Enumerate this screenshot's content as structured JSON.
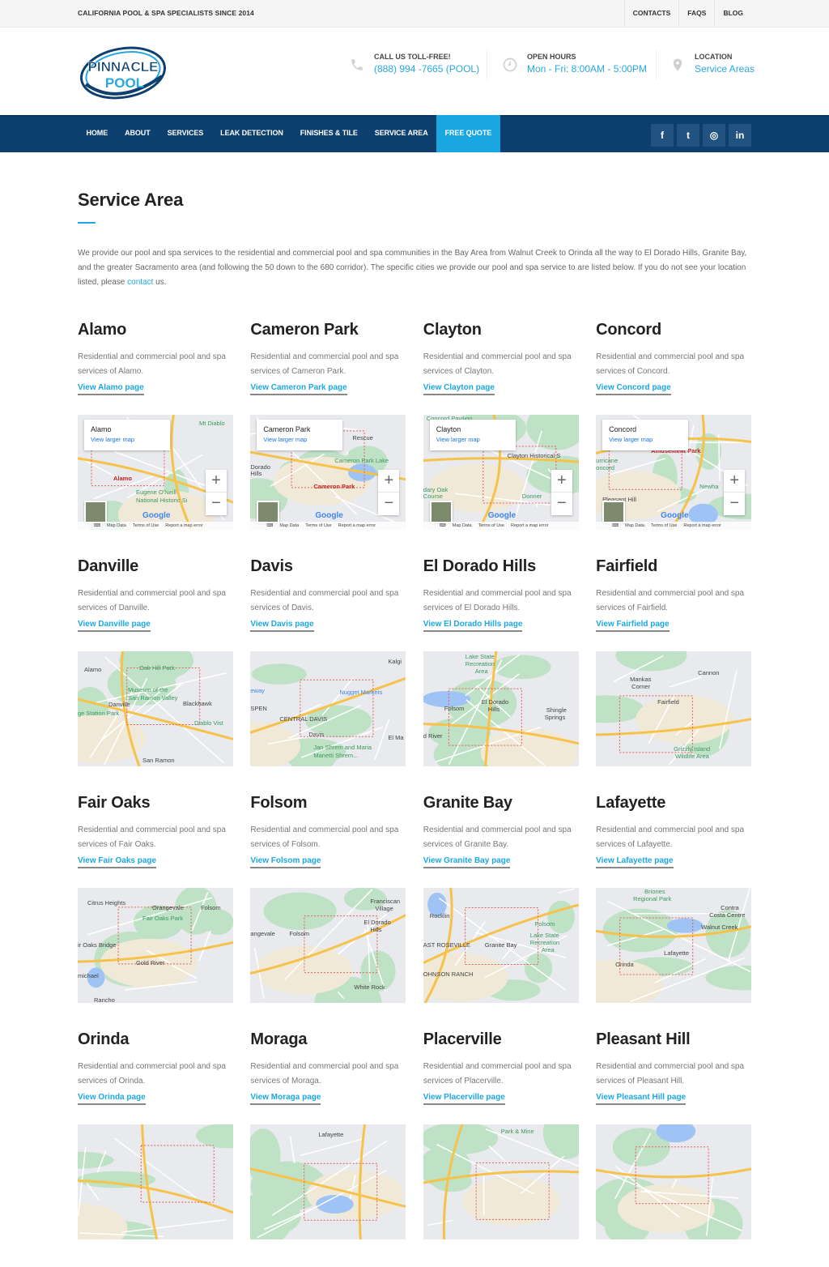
{
  "topbar": {
    "tagline": "CALIFORNIA POOL & SPA SPECIALISTS SINCE 2014",
    "links": [
      "CONTACTS",
      "FAQS",
      "BLOG"
    ]
  },
  "header": {
    "logo": {
      "line1": "PINNACLE",
      "line2": "POOL"
    },
    "info": [
      {
        "icon": "phone-icon",
        "label": "CALL US TOLL-FREE!",
        "value": "(888) 994 -7665 (POOL)"
      },
      {
        "icon": "clock-icon",
        "label": "OPEN HOURS",
        "value": "Mon - Fri: 8:00AM - 5:00PM"
      },
      {
        "icon": "location-pin-icon",
        "label": "LOCATION",
        "value": "Service Areas"
      }
    ]
  },
  "nav": {
    "items": [
      {
        "label": "HOME"
      },
      {
        "label": "ABOUT"
      },
      {
        "label": "SERVICES"
      },
      {
        "label": "LEAK DETECTION"
      },
      {
        "label": "FINISHES & TILE"
      },
      {
        "label": "SERVICE AREA"
      },
      {
        "label": "FREE QUOTE",
        "active": true
      }
    ],
    "social": [
      {
        "icon": "facebook-icon",
        "glyph": "f"
      },
      {
        "icon": "twitter-icon",
        "glyph": "t"
      },
      {
        "icon": "instagram-icon",
        "glyph": "◎"
      },
      {
        "icon": "linkedin-icon",
        "glyph": "in"
      }
    ]
  },
  "colors": {
    "brand_dark": "#0d3f6f",
    "accent": "#1ba8e2",
    "social_bg": "#22527f",
    "topbar_bg": "#f5f5f5"
  },
  "page": {
    "title": "Service Area",
    "intro_before": "We provide our pool and spa services to the residential and commercial pool and spa communities in the Bay Area from Walnut Creek to Orinda all the way to El Dorado Hills, Granite Bay, and the greater Sacramento area (and following the 50 down to the 680 corridor). The specific cities we provide our pool and spa service to are listed below. If you do not see your location listed, please ",
    "intro_link": "contact",
    "intro_after": " us."
  },
  "map_ui": {
    "view_larger": "View larger map",
    "zoom_in": "+",
    "zoom_out": "−",
    "google": "Google",
    "footer": [
      "Map Data",
      "Terms of Use",
      "Report a map error"
    ]
  },
  "cities": [
    {
      "name": "Alamo",
      "desc": "Residential and commercial pool and spa services of Alamo.",
      "link": "View Alamo page",
      "map": {
        "interactive": true,
        "title": "Alamo",
        "places": [
          [
            "Mt Diablo",
            150,
            6,
            "green"
          ],
          [
            "Alamo",
            44,
            74,
            "red"
          ],
          [
            "Eugene O'Neill",
            72,
            91,
            "green"
          ],
          [
            "National Historic Si",
            72,
            101,
            "green"
          ]
        ]
      }
    },
    {
      "name": "Cameron Park",
      "desc": "Residential and commercial pool and spa services of Cameron Park.",
      "link": "View Cameron Park page",
      "map": {
        "interactive": true,
        "title": "Cameron Park",
        "places": [
          [
            "Rescue",
            126,
            24,
            ""
          ],
          [
            "Cameron Park Lake",
            104,
            52,
            "green"
          ],
          [
            "Dorado",
            0,
            60,
            ""
          ],
          [
            "Hills",
            0,
            68,
            ""
          ],
          [
            "Cameron Park",
            78,
            84,
            "red"
          ]
        ]
      }
    },
    {
      "name": "Clayton",
      "desc": "Residential and commercial pool and spa services of Clayton.",
      "link": "View Clayton page",
      "map": {
        "interactive": true,
        "title": "Clayton",
        "places": [
          [
            "Concord Pavilion",
            4,
            0,
            "green"
          ],
          [
            "Clayton Historical S",
            104,
            46,
            ""
          ],
          [
            "dary Oak",
            0,
            88,
            "green"
          ],
          [
            "Course",
            0,
            96,
            "green"
          ],
          [
            "Donner",
            122,
            96,
            "green"
          ]
        ]
      }
    },
    {
      "name": "Concord",
      "desc": "Residential and commercial pool and spa services of Concord.",
      "link": "View Concord page",
      "map": {
        "interactive": true,
        "title": "Concord",
        "places": [
          [
            "Amusement Park",
            68,
            40,
            "red"
          ],
          [
            "urricane",
            0,
            52,
            "green"
          ],
          [
            "oncord",
            0,
            61,
            "green"
          ],
          [
            "Newha",
            128,
            84,
            "green"
          ],
          [
            "Pleasant Hill",
            8,
            100,
            ""
          ]
        ]
      }
    },
    {
      "name": "Danville",
      "desc": "Residential and commercial pool and spa services of Danville.",
      "link": "View Danville page",
      "map": {
        "interactive": false,
        "places": [
          [
            "Alamo",
            8,
            18,
            ""
          ],
          [
            "Oak Hill Park",
            76,
            16,
            "green"
          ],
          [
            "Museum of the",
            62,
            43,
            "green"
          ],
          [
            "San Ramon Valley",
            62,
            53,
            "green"
          ],
          [
            "Danville",
            38,
            61,
            ""
          ],
          [
            "Blackhawk",
            130,
            60,
            ""
          ],
          [
            "ge Station Park",
            0,
            72,
            "green"
          ],
          [
            "Diablo Vist",
            144,
            84,
            "green"
          ],
          [
            "San Ramon",
            80,
            130,
            ""
          ]
        ]
      }
    },
    {
      "name": "Davis",
      "desc": "Residential and commercial pool and spa services of Davis.",
      "link": "View Davis page",
      "map": {
        "interactive": false,
        "places": [
          [
            "Kalgi",
            170,
            8,
            ""
          ],
          [
            "eway",
            0,
            44,
            "blue"
          ],
          [
            "Nugget Markets",
            110,
            46,
            "blue"
          ],
          [
            "SPEN",
            0,
            66,
            ""
          ],
          [
            "CENTRAL DAVIS",
            36,
            79,
            ""
          ],
          [
            "Davis",
            72,
            98,
            ""
          ],
          [
            "El Ma",
            170,
            102,
            ""
          ],
          [
            "Jan Shrem and Maria",
            78,
            114,
            "green"
          ],
          [
            "Manetti Shrem...",
            78,
            124,
            "green"
          ]
        ]
      }
    },
    {
      "name": "El Dorado Hills",
      "desc": "Residential and commercial pool and spa services of El Dorado Hills.",
      "link": "View El Dorado Hills page",
      "map": {
        "interactive": false,
        "places": [
          [
            "Lake State",
            52,
            2,
            "green"
          ],
          [
            "Recreation",
            52,
            11,
            "green"
          ],
          [
            "Area",
            64,
            20,
            "green"
          ],
          [
            "El Dorado",
            72,
            58,
            ""
          ],
          [
            "Hills",
            80,
            67,
            ""
          ],
          [
            "Folsom",
            26,
            66,
            ""
          ],
          [
            "Shingle",
            152,
            68,
            ""
          ],
          [
            "Springs",
            150,
            77,
            ""
          ],
          [
            "d River",
            0,
            100,
            ""
          ]
        ]
      }
    },
    {
      "name": "Fairfield",
      "desc": "Residential and commercial pool and spa services of Fairfield.",
      "link": "View Fairfield page",
      "map": {
        "interactive": false,
        "places": [
          [
            "Cannon",
            126,
            22,
            ""
          ],
          [
            "Mankas",
            42,
            30,
            ""
          ],
          [
            "Corner",
            44,
            39,
            ""
          ],
          [
            "Fairfield",
            76,
            58,
            ""
          ],
          [
            "Grizzly Island",
            96,
            116,
            "green"
          ],
          [
            "Wildlife Area",
            98,
            125,
            "green"
          ]
        ]
      }
    },
    {
      "name": "Fair Oaks",
      "desc": "Residential and commercial pool and spa services of Fair Oaks.",
      "link": "View Fair Oaks page",
      "map": {
        "interactive": false,
        "places": [
          [
            "Citrus Heights",
            12,
            14,
            ""
          ],
          [
            "Orangevale",
            92,
            20,
            ""
          ],
          [
            "Folsom",
            152,
            20,
            ""
          ],
          [
            "Fair Oaks Park",
            80,
            33,
            "green"
          ],
          [
            "ir Oaks Bridge",
            0,
            66,
            ""
          ],
          [
            "Gold River",
            72,
            88,
            ""
          ],
          [
            "michael",
            0,
            104,
            ""
          ],
          [
            "Rancho",
            20,
            134,
            ""
          ]
        ]
      }
    },
    {
      "name": "Folsom",
      "desc": "Residential and commercial pool and spa services of Folsom.",
      "link": "View Folsom page",
      "map": {
        "interactive": false,
        "places": [
          [
            "Franciscan",
            148,
            12,
            ""
          ],
          [
            "Village",
            154,
            21,
            ""
          ],
          [
            "El Dorado",
            140,
            38,
            ""
          ],
          [
            "Hills",
            148,
            47,
            ""
          ],
          [
            "angevale",
            0,
            52,
            ""
          ],
          [
            "Folsom",
            48,
            52,
            ""
          ],
          [
            "White Rock",
            128,
            118,
            ""
          ]
        ]
      }
    },
    {
      "name": "Granite Bay",
      "desc": "Residential and commercial pool and spa services of Granite Bay.",
      "link": "View Granite Bay page",
      "map": {
        "interactive": false,
        "places": [
          [
            "Rocklin",
            8,
            30,
            ""
          ],
          [
            "Folsom",
            138,
            40,
            "green"
          ],
          [
            "Lake State",
            132,
            54,
            "green"
          ],
          [
            "Recreation",
            132,
            63,
            "green"
          ],
          [
            "Area",
            146,
            72,
            "green"
          ],
          [
            "Granite Bay",
            76,
            66,
            ""
          ],
          [
            "AST ROSEVILLE",
            0,
            66,
            ""
          ],
          [
            "OHNSON RANCH",
            0,
            102,
            ""
          ]
        ]
      }
    },
    {
      "name": "Lafayette",
      "desc": "Residential and commercial pool and spa services of Lafayette.",
      "link": "View Lafayette page",
      "map": {
        "interactive": false,
        "places": [
          [
            "Briones",
            60,
            0,
            "green"
          ],
          [
            "Regional Park",
            46,
            9,
            "green"
          ],
          [
            "Contra",
            154,
            20,
            ""
          ],
          [
            "Costa Centre",
            140,
            29,
            ""
          ],
          [
            "Walnut Creek",
            130,
            44,
            ""
          ],
          [
            "Lafayette",
            84,
            76,
            ""
          ],
          [
            "Orinda",
            24,
            90,
            ""
          ]
        ]
      }
    },
    {
      "name": "Orinda",
      "desc": "Residential and commercial pool and spa services of Orinda.",
      "link": "View Orinda page",
      "map": {
        "interactive": false,
        "places": []
      }
    },
    {
      "name": "Moraga",
      "desc": "Residential and commercial pool and spa services of Moraga.",
      "link": "View Moraga page",
      "map": {
        "interactive": false,
        "places": [
          [
            "Lafayette",
            84,
            8,
            ""
          ]
        ]
      }
    },
    {
      "name": "Placerville",
      "desc": "Residential and commercial pool and spa services of Placerville.",
      "link": "View Placerville page",
      "map": {
        "interactive": false,
        "places": [
          [
            "Park & Mine",
            96,
            4,
            "green"
          ]
        ]
      }
    },
    {
      "name": "Pleasant Hill",
      "desc": "Residential and commercial pool and spa services of Pleasant Hill.",
      "link": "View Pleasant Hill page",
      "map": {
        "interactive": false,
        "places": []
      }
    }
  ]
}
